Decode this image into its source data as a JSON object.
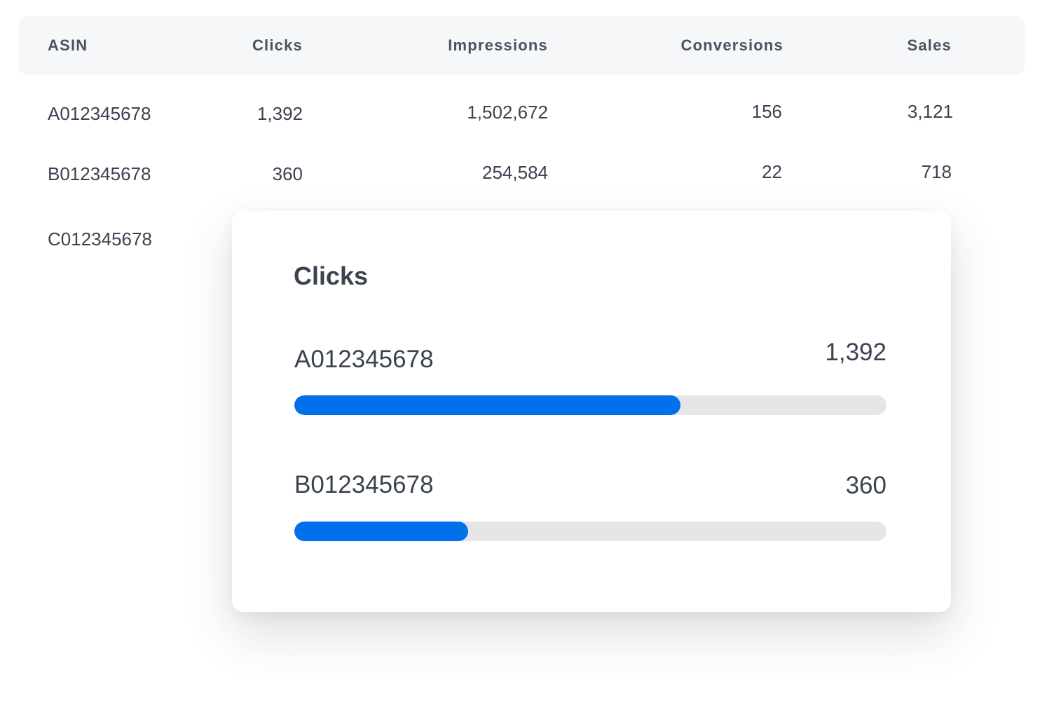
{
  "table": {
    "headers": [
      "ASIN",
      "Clicks",
      "Impressions",
      "Conversions",
      "Sales"
    ],
    "rows": [
      [
        "A012345678",
        "1,392",
        "1,502,672",
        "156",
        "3,121"
      ],
      [
        "B012345678",
        "360",
        "254,584",
        "22",
        "718"
      ],
      [
        "C012345678"
      ]
    ]
  },
  "popup": {
    "title": "Clicks",
    "bars": [
      {
        "label": "A012345678",
        "value": "1,392",
        "fill_fraction": 0.652
      },
      {
        "label": "B012345678",
        "value": "360",
        "fill_fraction": 0.294
      }
    ],
    "colors": {
      "fill": "#0070eb",
      "track": "#e6e6e7"
    }
  }
}
